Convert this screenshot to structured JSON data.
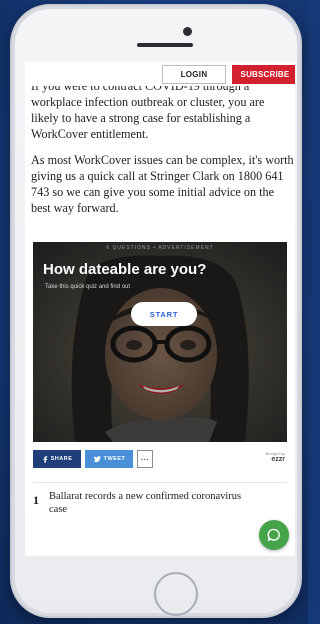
{
  "header": {
    "login_label": "LOGIN",
    "subscribe_label": "SUBSCRIBE"
  },
  "article": {
    "paragraph_1": "If you were to contract COVID-19 through a workplace infection outbreak or cluster, you are likely to have a strong case for establishing a WorkCover entitlement.",
    "paragraph_2": "As most WorkCover issues can be complex, it's worth giving us a quick call at Stringer Clark on 1800 641 743 so we can give you some initial advice on the best way forward."
  },
  "quiz_ad": {
    "label": "6 QUESTIONS • ADVERTISEMENT",
    "title": "How dateable are you?",
    "subtitle": "Take this quick quiz and find out",
    "start_label": "START",
    "share_label": "SHARE",
    "tweet_label": "TWEET",
    "more_label": "···",
    "brand_caption": "Brought by",
    "brand_name": "ezzr"
  },
  "trending": {
    "items": [
      {
        "number": "1",
        "headline": "Ballarat records a new confirmed coronavirus case"
      }
    ]
  },
  "colors": {
    "background": "#163a78",
    "subscribe": "#d3202f",
    "share": "#1f3f7a",
    "tweet": "#4a90d9",
    "chat": "#45a34a",
    "start_text": "#2a5fd4"
  },
  "icons": [
    "facebook-icon",
    "twitter-icon",
    "more-icon",
    "chat-icon"
  ]
}
